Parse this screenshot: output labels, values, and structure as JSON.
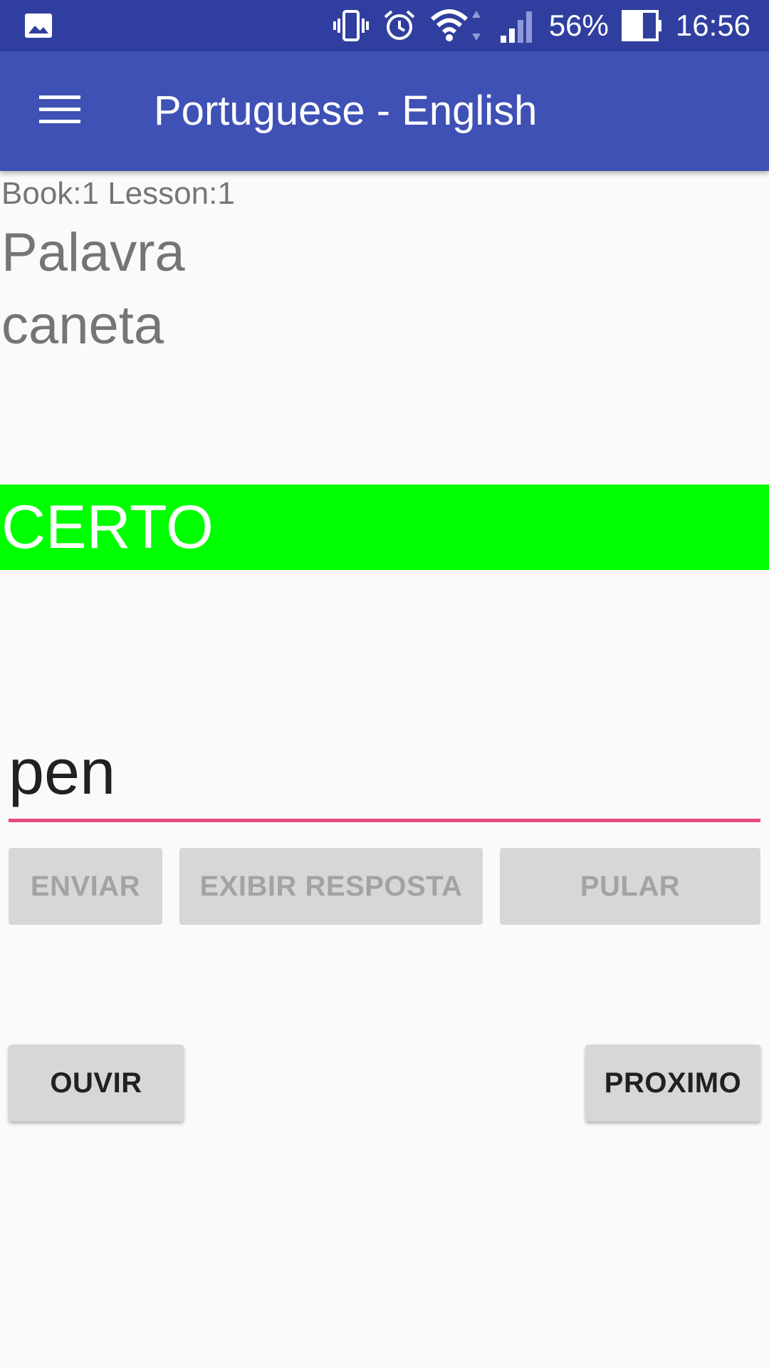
{
  "status_bar": {
    "battery_percent": "56%",
    "time": "16:56",
    "icons": [
      "gallery-icon",
      "vibrate-icon",
      "alarm-icon",
      "wifi-icon",
      "signal-icon",
      "battery-icon"
    ]
  },
  "app_bar": {
    "title": "Portuguese - English",
    "menu_icon": "hamburger-menu-icon"
  },
  "lesson": {
    "info": "Book:1 Lesson:1",
    "word_type": "Palavra",
    "word": "caneta"
  },
  "result": {
    "text": "CERTO",
    "color": "#00ff00"
  },
  "answer": {
    "value": "pen"
  },
  "buttons": {
    "enviar": "ENVIAR",
    "exibir_resposta": "EXIBIR RESPOSTA",
    "pular": "PULAR",
    "ouvir": "OUVIR",
    "proximo": "PROXIMO"
  },
  "colors": {
    "status_bar": "#303f9f",
    "app_bar": "#3f51b5",
    "accent": "#e84a7f"
  }
}
